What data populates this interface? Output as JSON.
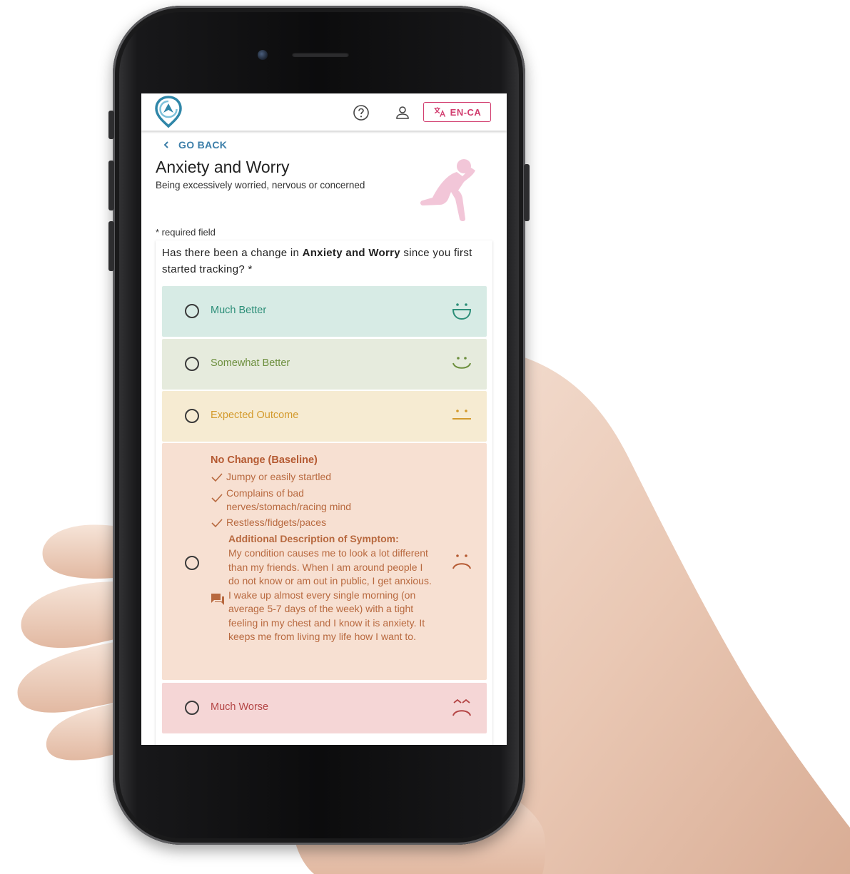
{
  "header": {
    "language_label": "EN-CA"
  },
  "nav": {
    "back_label": "GO BACK"
  },
  "page": {
    "title": "Anxiety and Worry",
    "subtitle": "Being excessively worried, nervous or concerned",
    "required_note": "* required field"
  },
  "question": {
    "prefix": "Has there been a change in ",
    "symptom": "Anxiety and Worry",
    "suffix": " since you first started tracking? *"
  },
  "options": [
    {
      "label": "Much Better",
      "face": "big-smile-icon",
      "color": "#2c8e78"
    },
    {
      "label": "Somewhat Better",
      "face": "smile-icon",
      "color": "#6d8f3e"
    },
    {
      "label": "Expected Outcome",
      "face": "neutral-face-icon",
      "color": "#d39a2c"
    },
    {
      "label": "No Change (Baseline)",
      "face": "frown-icon",
      "color": "#b55a32",
      "symptoms": [
        "Jumpy or easily startled",
        "Complains of bad nerves/stomach/racing mind",
        "Restless/fidgets/paces"
      ],
      "description_title": "Additional Description of Symptom:",
      "description": "My condition causes me to look a lot different than my friends. When I am around people I do not know or am out in public, I get anxious. I wake up almost every single morning (on average 5-7 days of the week) with a tight feeling in my chest and I know it is anxiety. It keeps me from living my life how I want to."
    },
    {
      "label": "Much Worse",
      "face": "sad-face-icon",
      "color": "#b44545"
    }
  ]
}
